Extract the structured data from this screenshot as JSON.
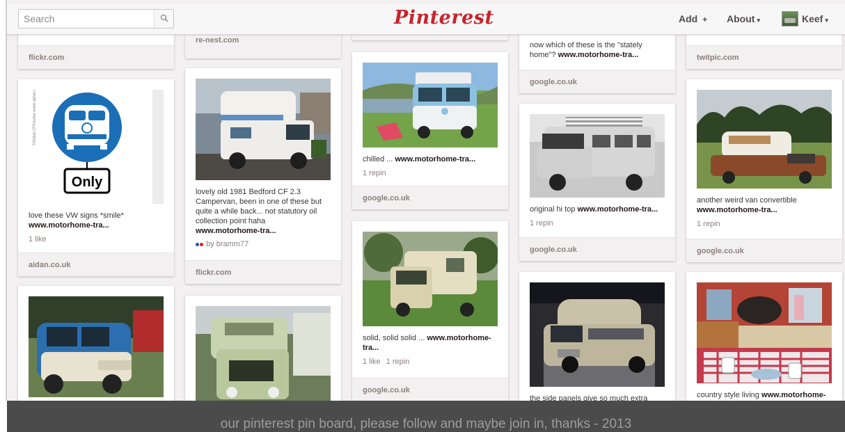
{
  "header": {
    "search_placeholder": "Search",
    "logo": "Pinterest",
    "add_label": "Add",
    "add_symbol": "+",
    "about_label": "About",
    "user_label": "Keef",
    "caret": "▾"
  },
  "pins": [
    {
      "source": "flickr.com"
    },
    {
      "source": "re-nest.com"
    },
    {
      "source": ""
    },
    {
      "desc_line1": "now which of these is the \"stately",
      "desc_line2": "home\"?",
      "desc_link": "www.motorhome-tra...",
      "source": "google.co.uk"
    },
    {
      "source": "twitpic.com"
    },
    {
      "image_label": "Only",
      "desc": "love these VW signs *smile*",
      "desc_link": "www.motorhome-tra...",
      "stats": [
        "1 like"
      ],
      "source": "aidan.co.uk"
    },
    {
      "desc": "lovely old 1981 Bedford CF 2.3 Campervan, been in one of these but quite a while back... not statutory oil collection point haha",
      "desc_link": "www.motorhome-tra...",
      "by": "by bramm77",
      "source": "flickr.com"
    },
    {
      "desc": "chilled ...",
      "desc_link": "www.motorhome-tra...",
      "stats": [
        "1 repin"
      ],
      "source": "google.co.uk"
    },
    {
      "desc": "original hi top",
      "desc_link": "www.motorhome-tra...",
      "stats": [
        "1 repin"
      ],
      "source": "google.co.uk"
    },
    {
      "desc": "another weird van convertible",
      "desc_link": "www.motorhome-tra...",
      "stats": [
        "1 repin"
      ],
      "source": "google.co.uk"
    },
    {
      "desc": "solid, solid solid ...",
      "desc_link": "www.motorhome-tra...",
      "stats": [
        "1 like",
        "1 repin"
      ],
      "source": "google.co.uk"
    },
    {
      "desc": "the side panels give so much extra"
    },
    {
      "desc": "country style living",
      "desc_link": "www.motorhome-"
    }
  ],
  "footer": {
    "caption": "our pinterest pin board, please follow and maybe join in, thanks - 2013"
  },
  "colors": {
    "brand": "#c8232c",
    "background": "#f2f0f0",
    "footer": "#4b4b4b"
  }
}
